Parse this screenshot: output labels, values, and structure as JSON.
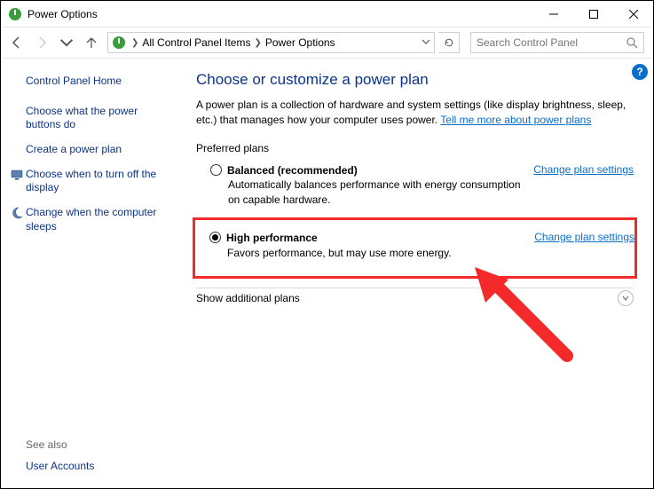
{
  "window": {
    "title": "Power Options"
  },
  "breadcrumb": {
    "items": [
      "All Control Panel Items",
      "Power Options"
    ]
  },
  "search": {
    "placeholder": "Search Control Panel"
  },
  "sidebar": {
    "home": "Control Panel Home",
    "links": [
      "Choose what the power buttons do",
      "Create a power plan",
      "Choose when to turn off the display",
      "Change when the computer sleeps"
    ],
    "seealso_label": "See also",
    "seealso_links": [
      "User Accounts"
    ]
  },
  "main": {
    "heading": "Choose or customize a power plan",
    "intro_pre": "A power plan is a collection of hardware and system settings (like display brightness, sleep, etc.) that manages how your computer uses power. ",
    "intro_link": "Tell me more about power plans",
    "preferred_label": "Preferred plans",
    "plans": [
      {
        "name": "Balanced (recommended)",
        "desc": "Automatically balances performance with energy consumption on capable hardware.",
        "change": "Change plan settings"
      },
      {
        "name": "High performance",
        "desc": "Favors performance, but may use more energy.",
        "change": "Change plan settings"
      }
    ],
    "show_more": "Show additional plans"
  },
  "help_icon": "?"
}
